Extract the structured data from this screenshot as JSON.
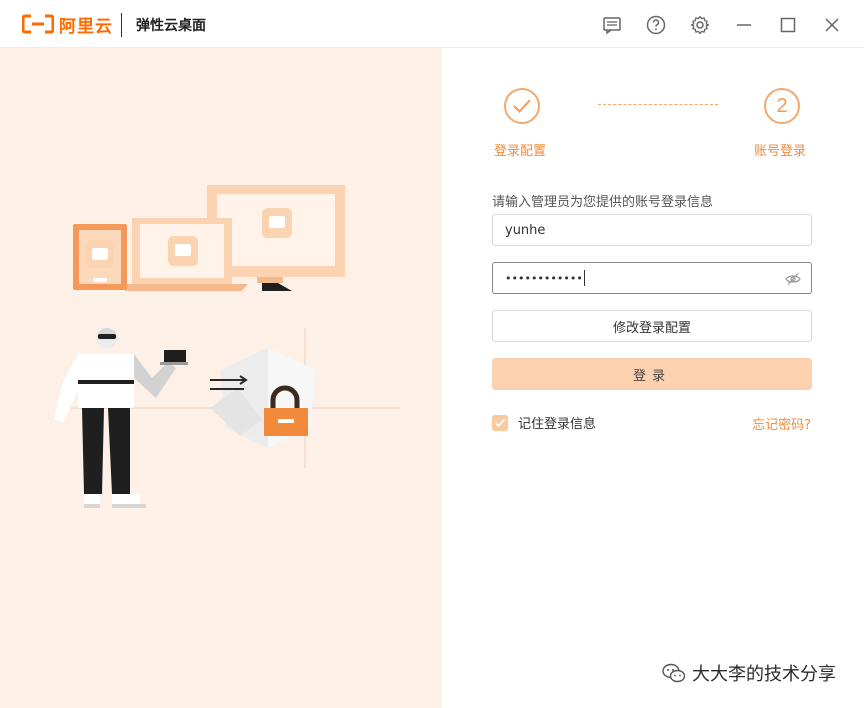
{
  "titlebar": {
    "brand": "阿里云",
    "app_title": "弹性云桌面",
    "icons": [
      "message-icon",
      "help-icon",
      "settings-icon",
      "minimize-icon",
      "maximize-icon",
      "close-icon"
    ]
  },
  "steps": {
    "step1": {
      "label": "登录配置",
      "state": "done"
    },
    "step2": {
      "label": "账号登录",
      "number": "2",
      "state": "current"
    }
  },
  "form": {
    "instruction": "请输入管理员为您提供的账号登录信息",
    "username": "yunhe",
    "password_mask": "••••••••••••",
    "modify_config_label": "修改登录配置",
    "login_label": "登录",
    "remember_label": "记住登录信息",
    "remember_checked": true,
    "forgot_label": "忘记密码?"
  },
  "watermark": {
    "text": "大大李的技术分享"
  },
  "colors": {
    "brand": "#ff6a00",
    "accent": "#f28a3c",
    "left_bg": "#fdf0e6",
    "primary_btn": "#fcd1b0"
  }
}
